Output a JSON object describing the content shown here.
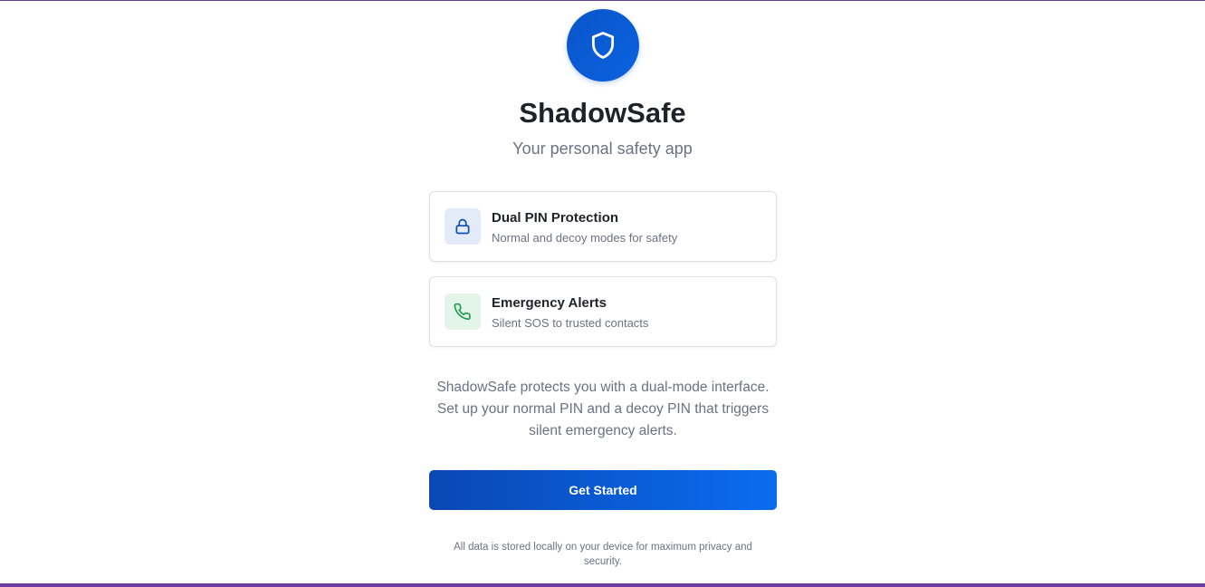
{
  "brand": {
    "name": "ShadowSafe",
    "tagline": "Your personal safety app",
    "logo_icon": "shield-icon",
    "accent_color": "#0b5ed7",
    "frame_color": "#6b3fa0"
  },
  "features": [
    {
      "icon": "lock-icon",
      "title": "Dual PIN Protection",
      "description": "Normal and decoy modes for safety",
      "icon_color": "#0b4fb8"
    },
    {
      "icon": "phone-icon",
      "title": "Emergency Alerts",
      "description": "Silent SOS to trusted contacts",
      "icon_color": "#1f9d50"
    }
  ],
  "description": "ShadowSafe protects you with a dual-mode interface. Set up your normal PIN and a decoy PIN that triggers silent emergency alerts.",
  "cta": {
    "label": "Get Started"
  },
  "footnote": "All data is stored locally on your device for maximum privacy and security."
}
